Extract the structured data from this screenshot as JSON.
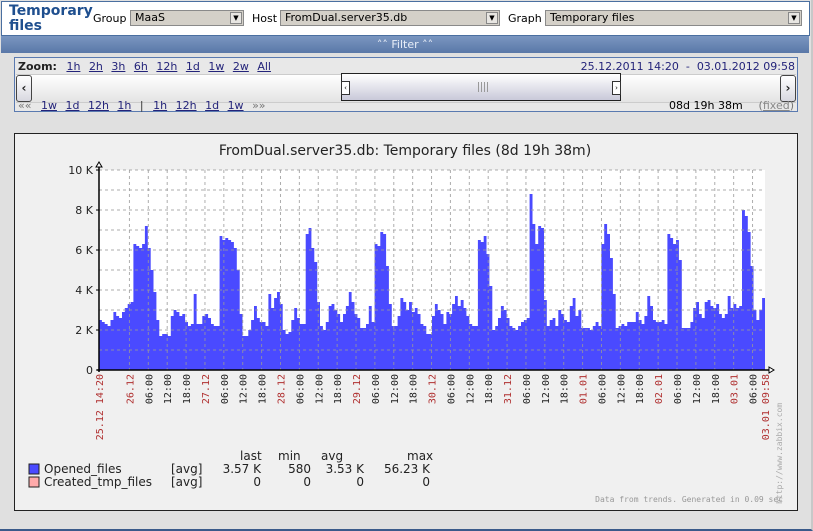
{
  "header": {
    "title": "Temporary files",
    "group_label": "Group",
    "group_value": "MaaS",
    "host_label": "Host",
    "host_value": "FromDual.server35.db",
    "graph_label": "Graph",
    "graph_value": "Temporary files"
  },
  "filter": {
    "label": "Filter",
    "icon": "double-chevron-up-icon"
  },
  "zoom": {
    "label": "Zoom:",
    "links": [
      "1h",
      "2h",
      "3h",
      "6h",
      "12h",
      "1d",
      "1w",
      "2w",
      "All"
    ],
    "period_from": "25.12.2011 14:20",
    "period_sep": "-",
    "period_to": "03.01.2012 09:58",
    "back_nav": "««",
    "back_links": [
      "1w",
      "1d",
      "12h",
      "1h"
    ],
    "separator": "|",
    "fwd_links": [
      "1h",
      "12h",
      "1d",
      "1w"
    ],
    "fwd_nav": "»»",
    "duration": "08d 19h 38m",
    "fixed_label": "fixed"
  },
  "graph": {
    "title": "FromDual.server35.db: Temporary files  (8d 19h 38m)",
    "watermark": "http://www.zabbix.com",
    "generated": "Data from trends. Generated in 0.09 sec",
    "legend_headers": [
      "last",
      "min",
      "avg",
      "max"
    ],
    "legend": [
      {
        "name": "Opened_files",
        "func": "[avg]",
        "last": "3.57 K",
        "min": "580",
        "avg": "3.53 K",
        "max": "56.23 K",
        "color": "#4a4aff"
      },
      {
        "name": "Created_tmp_files",
        "func": "[avg]",
        "last": "0",
        "min": "0",
        "avg": "0",
        "max": "0",
        "color": "#ffaaaa"
      }
    ]
  },
  "chart_data": {
    "type": "area",
    "title": "FromDual.server35.db: Temporary files  (8d 19h 38m)",
    "xlabel": "",
    "ylabel": "",
    "ylim": [
      0,
      10000
    ],
    "y_ticks": [
      "0",
      "2 K",
      "4 K",
      "6 K",
      "8 K",
      "10 K"
    ],
    "x_range": [
      "25.12 14:20",
      "03.01 09:58"
    ],
    "x_ticks": [
      {
        "label": "25.12 14:20",
        "h": 0,
        "date": true
      },
      {
        "label": "26.12",
        "h": 9.67,
        "date": true
      },
      {
        "label": "06:00",
        "h": 15.67
      },
      {
        "label": "12:00",
        "h": 21.67
      },
      {
        "label": "18:00",
        "h": 27.67
      },
      {
        "label": "27.12",
        "h": 33.67,
        "date": true
      },
      {
        "label": "06:00",
        "h": 39.67
      },
      {
        "label": "12:00",
        "h": 45.67
      },
      {
        "label": "18:00",
        "h": 51.67
      },
      {
        "label": "28.12",
        "h": 57.67,
        "date": true
      },
      {
        "label": "06:00",
        "h": 63.67
      },
      {
        "label": "12:00",
        "h": 69.67
      },
      {
        "label": "18:00",
        "h": 75.67
      },
      {
        "label": "29.12",
        "h": 81.67,
        "date": true
      },
      {
        "label": "06:00",
        "h": 87.67
      },
      {
        "label": "12:00",
        "h": 93.67
      },
      {
        "label": "18:00",
        "h": 99.67
      },
      {
        "label": "30.12",
        "h": 105.67,
        "date": true
      },
      {
        "label": "06:00",
        "h": 111.67
      },
      {
        "label": "12:00",
        "h": 117.67
      },
      {
        "label": "18:00",
        "h": 123.67
      },
      {
        "label": "31.12",
        "h": 129.67,
        "date": true
      },
      {
        "label": "06:00",
        "h": 135.67
      },
      {
        "label": "12:00",
        "h": 141.67
      },
      {
        "label": "18:00",
        "h": 147.67
      },
      {
        "label": "01.01",
        "h": 153.67,
        "date": true
      },
      {
        "label": "06:00",
        "h": 159.67
      },
      {
        "label": "12:00",
        "h": 165.67
      },
      {
        "label": "18:00",
        "h": 171.67
      },
      {
        "label": "02.01",
        "h": 177.67,
        "date": true
      },
      {
        "label": "06:00",
        "h": 183.67
      },
      {
        "label": "12:00",
        "h": 189.67
      },
      {
        "label": "18:00",
        "h": 195.67
      },
      {
        "label": "03.01",
        "h": 201.67,
        "date": true
      },
      {
        "label": "06:00",
        "h": 207.67
      },
      {
        "label": "03.01 09:58",
        "h": 211.63,
        "date": true
      }
    ],
    "grid": true,
    "series": [
      {
        "name": "Opened_files",
        "color": "#4a4aff",
        "step_hours": 1.5,
        "values": [
          2500,
          2400,
          2300,
          2200,
          2500,
          2900,
          2700,
          2600,
          2900,
          3100,
          3300,
          3400,
          6300,
          6200,
          6100,
          6300,
          7200,
          6100,
          5000,
          3900,
          2500,
          1700,
          1800,
          1800,
          1700,
          2700,
          3000,
          2900,
          2700,
          2800,
          2400,
          2200,
          2300,
          3800,
          2300,
          2300,
          2700,
          2800,
          2600,
          2300,
          2200,
          2200,
          6700,
          6500,
          6600,
          6500,
          6400,
          6100,
          5000,
          2800,
          1700,
          1700,
          2000,
          2500,
          3200,
          2600,
          2400,
          2400,
          2200,
          3800,
          3100,
          3600,
          3900,
          3300,
          2000,
          1800,
          1900,
          2500,
          3100,
          2600,
          2300,
          2300,
          6800,
          7100,
          6100,
          5400,
          3400,
          2200,
          2000,
          2400,
          3200,
          3300,
          3000,
          2800,
          2400,
          2800,
          3200,
          3900,
          3400,
          2800,
          2600,
          2100,
          2100,
          2300,
          3200,
          2400,
          6300,
          6200,
          6900,
          6800,
          5200,
          3300,
          2200,
          2200,
          2700,
          3600,
          3400,
          3000,
          3400,
          2900,
          3100,
          2800,
          2300,
          2200,
          1800,
          1800,
          2700,
          3300,
          3000,
          2800,
          2300,
          2900,
          2800,
          3300,
          3700,
          3200,
          3500,
          3100,
          2700,
          2300,
          2200,
          2200,
          6500,
          6400,
          6700,
          5800,
          4200,
          2000,
          2200,
          2600,
          3200,
          3000,
          2600,
          2200,
          2100,
          2000,
          2200,
          2400,
          2500,
          2600,
          8800,
          7300,
          6300,
          7200,
          7100,
          3500,
          2200,
          2500,
          2600,
          2200,
          3000,
          2800,
          2500,
          2400,
          3200,
          3600,
          2700,
          3000,
          2100,
          2100,
          2100,
          2000,
          2200,
          2400,
          2200,
          6300,
          7300,
          6800,
          5600,
          3800,
          2100,
          2200,
          2300,
          2200,
          2400,
          2400,
          2400,
          2900,
          2500,
          2300,
          2700,
          3700,
          3200,
          2500,
          2400,
          2400,
          2500,
          2300,
          6800,
          6600,
          6300,
          6500,
          5500,
          2100,
          2100,
          2100,
          2400,
          3100,
          3400,
          2800,
          2600,
          3400,
          3500,
          3200,
          3100,
          3300,
          2800,
          2600,
          2800,
          3700,
          3100,
          3300,
          3100,
          3200,
          8000,
          7700,
          6900,
          5200,
          3000,
          2500,
          3000,
          3600
        ]
      },
      {
        "name": "Created_tmp_files",
        "color": "#ffaaaa",
        "values": [
          0
        ]
      }
    ]
  }
}
